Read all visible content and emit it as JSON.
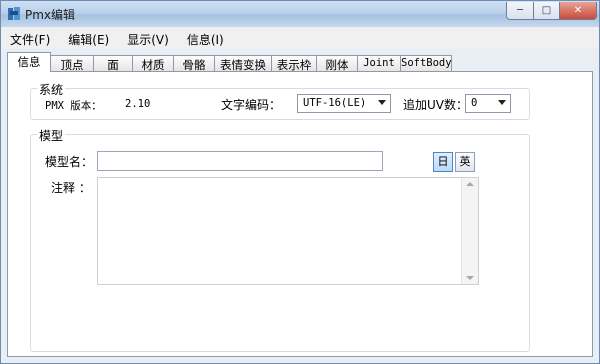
{
  "window": {
    "title": "Pmx编辑"
  },
  "titlebar": {
    "min_glyph": "─",
    "max_glyph": "□",
    "close_glyph": "✕"
  },
  "menu": [
    "文件(F)",
    "编辑(E)",
    "显示(V)",
    "信息(I)"
  ],
  "tabs": [
    "信息",
    "顶点",
    "面",
    "材质",
    "骨骼",
    "表情变换",
    "表示枠",
    "刚体",
    "Joint",
    "SoftBody"
  ],
  "active_tab": "信息",
  "system": {
    "title": "系统",
    "pmx_version_label": "PMX 版本：",
    "pmx_version_value": "2.10",
    "encoding_label": "文字编码：",
    "encoding_value": "UTF-16(LE)",
    "uv_label": "追加UV数：",
    "uv_value": "0"
  },
  "model": {
    "title": "模型",
    "name_label": "模型名：",
    "name_value": "",
    "comment_label": "注释 ：",
    "comment_value": "",
    "lang_jp": "日",
    "lang_en": "英"
  }
}
